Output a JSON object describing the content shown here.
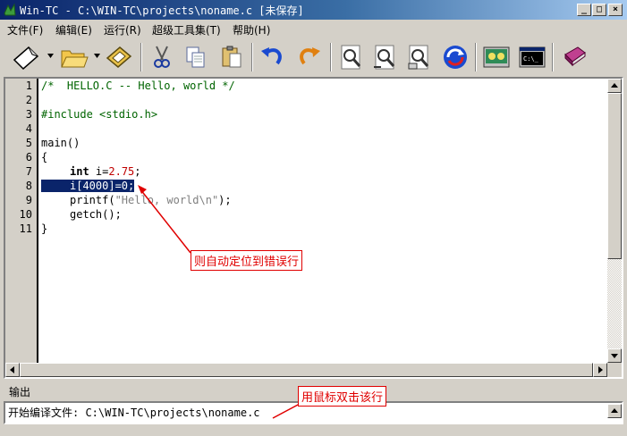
{
  "window": {
    "title": "Win-TC - C:\\WIN-TC\\projects\\noname.c [未保存]",
    "minimize_glyph": "_",
    "maximize_glyph": "□",
    "close_glyph": "×"
  },
  "menu": [
    {
      "label": "文件(F)"
    },
    {
      "label": "编辑(E)"
    },
    {
      "label": "运行(R)"
    },
    {
      "label": "超级工具集(T)"
    },
    {
      "label": "帮助(H)"
    }
  ],
  "toolbar": {
    "icons": [
      "new-file-icon",
      "open-folder-icon",
      "save-disk-icon",
      "cut-icon",
      "copy-icon",
      "paste-icon",
      "undo-icon",
      "redo-icon",
      "find-icon",
      "find-next-icon",
      "replace-icon",
      "refresh-icon",
      "compile-icon",
      "run-console-icon",
      "help-book-icon"
    ]
  },
  "editor": {
    "line_numbers": [
      "1",
      "2",
      "3",
      "4",
      "5",
      "6",
      "7",
      "8",
      "9",
      "10",
      "11"
    ],
    "code": {
      "l1": "/*  HELLO.C -- Hello, world */",
      "l3": "#include <stdio.h>",
      "l5": "main()",
      "l6": "{",
      "l7_kw": "int",
      "l7_a": " i=",
      "l7_num": "2.75",
      "l7_b": ";",
      "l8": "i[4000]=0;",
      "l9_a": "printf(",
      "l9_str": "\"Hello, world\\n\"",
      "l9_b": ");",
      "l10": "getch();",
      "l11": "}"
    }
  },
  "output": {
    "label": "输出",
    "line": "开始编译文件: C:\\WIN-TC\\projects\\noname.c"
  },
  "annotations": {
    "error_line_note": "则自动定位到错误行",
    "double_click_note": "用鼠标双击该行"
  },
  "colors": {
    "selection": "#0a246a",
    "annotation": "#e00000",
    "comment": "#006400",
    "number": "#c00000"
  }
}
